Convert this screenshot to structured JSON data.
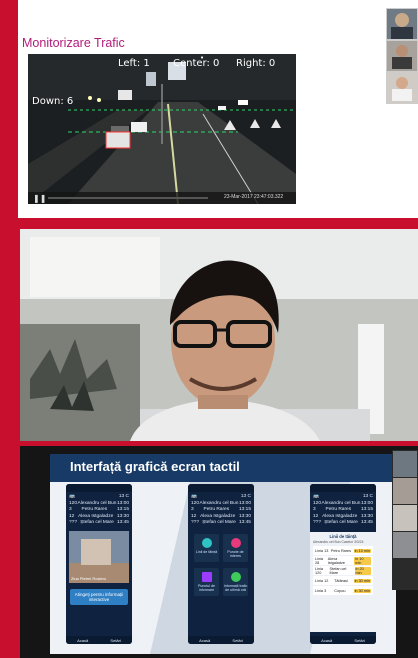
{
  "panel1": {
    "title": "Monitorizare Trafic",
    "counters": {
      "left": "Left: 1",
      "center": "Center: 0",
      "right": "Right: 0",
      "down": "Down: 6"
    },
    "timestamp": "23-Mar-2017 23:47:03.322"
  },
  "panel3": {
    "title": "Interfață grafică ecran tactil",
    "schedule": [
      {
        "line": "120",
        "dest": "Alexandru cel Bun",
        "time": "13:00"
      },
      {
        "line": "3",
        "dest": "Petru Rares",
        "time": "13:15"
      },
      {
        "line": "12",
        "dest": "Alexa Istgaladze",
        "time": "13:30"
      },
      {
        "line": "???",
        "dest": "Ștefan cel Mare",
        "time": "13:45"
      }
    ],
    "weather": "13 C",
    "left_phone": {
      "caption": "Ziua Pietrei Rosieru",
      "button": "Atingeți pentru informații interactive",
      "nav": [
        "Acasă",
        "Setări"
      ]
    },
    "mid_phone": {
      "tiles": [
        {
          "label": "Linii de tăință",
          "icon": "clock-icon",
          "color": "#2ec4c4"
        },
        {
          "label": "Puncte de interes",
          "icon": "map-pin-icon",
          "color": "#e63a7c"
        },
        {
          "label": "Punctul de informare",
          "icon": "map-icon",
          "color": "#9b3cff"
        },
        {
          "label": "Informații trafic de ultimă oră",
          "icon": "warning-icon",
          "color": "#3ecb5a"
        }
      ],
      "nav": [
        "Acasă",
        "Setări"
      ]
    },
    "right_phone": {
      "header": "Linii de tăință",
      "subheader": "Alexandru cel Bun Caselor 3/3/24",
      "rows": [
        {
          "line": "Linia 13",
          "name": "Petru Rares",
          "eta": "in 10 min"
        },
        {
          "line": "Linia 28",
          "name": "Alexa Istgaladze",
          "eta": "in 10 min"
        },
        {
          "line": "Linia 120",
          "name": "Ștefan cel Mare",
          "eta": "in 20 min"
        },
        {
          "line": "Linia 12",
          "name": "Tătărași",
          "eta": "in 30 min"
        },
        {
          "line": "Linia 3",
          "name": "Copou",
          "eta": "in 30 min"
        }
      ],
      "nav": [
        "Acasă",
        "Setări"
      ]
    }
  }
}
